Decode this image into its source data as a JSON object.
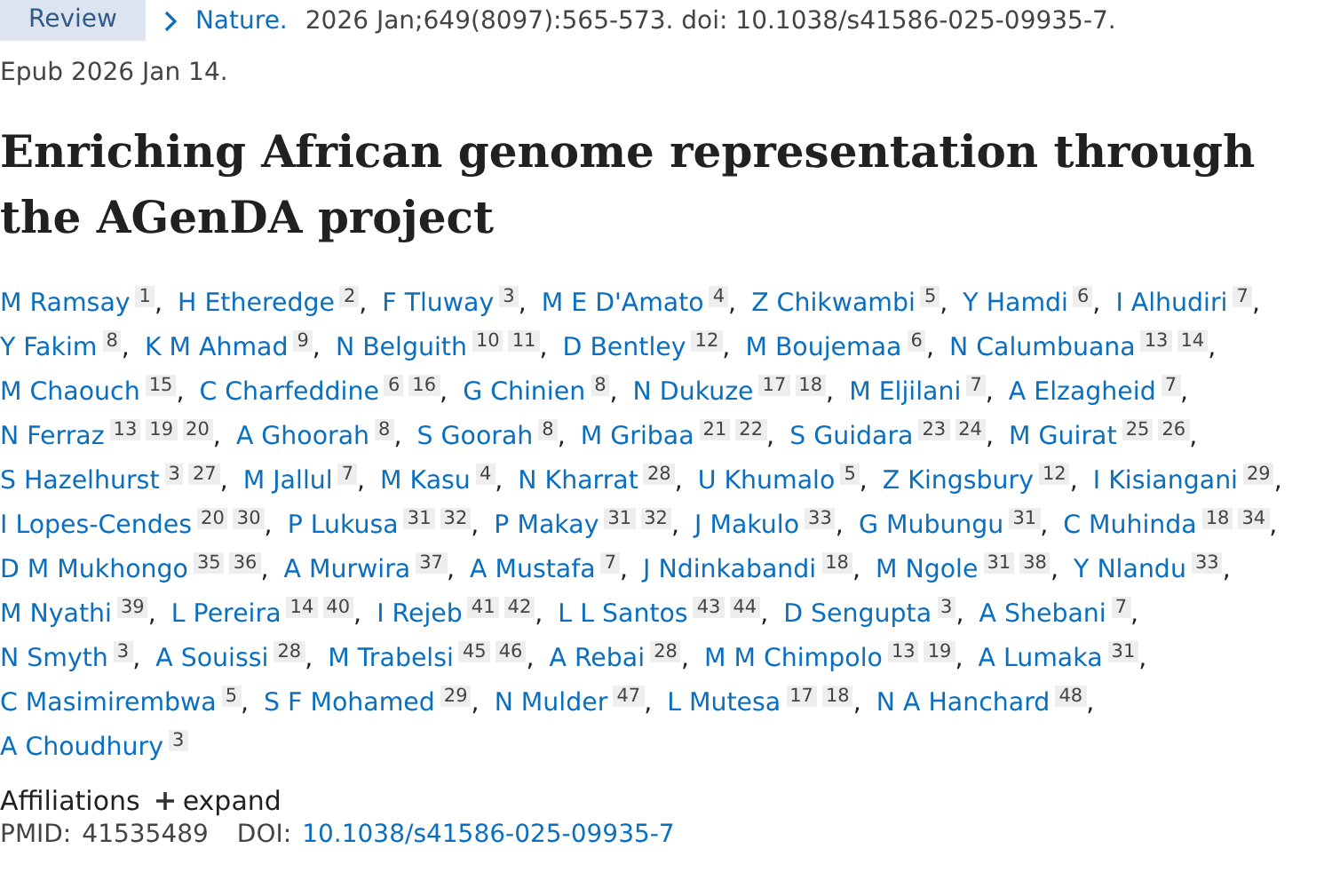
{
  "citation": {
    "badge": "Review",
    "journal": "Nature.",
    "details": "2026 Jan;649(8097):565-573. doi: 10.1038/s41586-025-09935-7.",
    "epub": "Epub 2026 Jan 14."
  },
  "title": "Enriching African genome representation through the AGenDA project",
  "authors": [
    {
      "name": "M Ramsay",
      "affiliations": [
        "1"
      ],
      "separator": ","
    },
    {
      "name": "H Etheredge",
      "affiliations": [
        "2"
      ],
      "separator": ","
    },
    {
      "name": "F Tluway",
      "affiliations": [
        "3"
      ],
      "separator": ","
    },
    {
      "name": "M E D'Amato",
      "affiliations": [
        "4"
      ],
      "separator": ","
    },
    {
      "name": "Z Chikwambi",
      "affiliations": [
        "5"
      ],
      "separator": ","
    },
    {
      "name": "Y Hamdi",
      "affiliations": [
        "6"
      ],
      "separator": ","
    },
    {
      "name": "I Alhudiri",
      "affiliations": [
        "7"
      ],
      "separator": ","
    },
    {
      "name": "Y Fakim",
      "affiliations": [
        "8"
      ],
      "separator": ","
    },
    {
      "name": "K M Ahmad",
      "affiliations": [
        "9"
      ],
      "separator": ","
    },
    {
      "name": "N Belguith",
      "affiliations": [
        "10",
        "11"
      ],
      "separator": ","
    },
    {
      "name": "D Bentley",
      "affiliations": [
        "12"
      ],
      "separator": ","
    },
    {
      "name": "M Boujemaa",
      "affiliations": [
        "6"
      ],
      "separator": ","
    },
    {
      "name": "N Calumbuana",
      "affiliations": [
        "13",
        "14"
      ],
      "separator": ","
    },
    {
      "name": "M Chaouch",
      "affiliations": [
        "15"
      ],
      "separator": ","
    },
    {
      "name": "C Charfeddine",
      "affiliations": [
        "6",
        "16"
      ],
      "separator": ","
    },
    {
      "name": "G Chinien",
      "affiliations": [
        "8"
      ],
      "separator": ","
    },
    {
      "name": "N Dukuze",
      "affiliations": [
        "17",
        "18"
      ],
      "separator": ","
    },
    {
      "name": "M Eljilani",
      "affiliations": [
        "7"
      ],
      "separator": ","
    },
    {
      "name": "A Elzagheid",
      "affiliations": [
        "7"
      ],
      "separator": ","
    },
    {
      "name": "N Ferraz",
      "affiliations": [
        "13",
        "19",
        "20"
      ],
      "separator": ","
    },
    {
      "name": "A Ghoorah",
      "affiliations": [
        "8"
      ],
      "separator": ","
    },
    {
      "name": "S Goorah",
      "affiliations": [
        "8"
      ],
      "separator": ","
    },
    {
      "name": "M Gribaa",
      "affiliations": [
        "21",
        "22"
      ],
      "separator": ","
    },
    {
      "name": "S Guidara",
      "affiliations": [
        "23",
        "24"
      ],
      "separator": ","
    },
    {
      "name": "M Guirat",
      "affiliations": [
        "25",
        "26"
      ],
      "separator": ","
    },
    {
      "name": "S Hazelhurst",
      "affiliations": [
        "3",
        "27"
      ],
      "separator": ","
    },
    {
      "name": "M Jallul",
      "affiliations": [
        "7"
      ],
      "separator": ","
    },
    {
      "name": "M Kasu",
      "affiliations": [
        "4"
      ],
      "separator": ","
    },
    {
      "name": "N Kharrat",
      "affiliations": [
        "28"
      ],
      "separator": ","
    },
    {
      "name": "U Khumalo",
      "affiliations": [
        "5"
      ],
      "separator": ","
    },
    {
      "name": "Z Kingsbury",
      "affiliations": [
        "12"
      ],
      "separator": ","
    },
    {
      "name": "I Kisiangani",
      "affiliations": [
        "29"
      ],
      "separator": ","
    },
    {
      "name": "I Lopes-Cendes",
      "affiliations": [
        "20",
        "30"
      ],
      "separator": ","
    },
    {
      "name": "P Lukusa",
      "affiliations": [
        "31",
        "32"
      ],
      "separator": ","
    },
    {
      "name": "P Makay",
      "affiliations": [
        "31",
        "32"
      ],
      "separator": ","
    },
    {
      "name": "J Makulo",
      "affiliations": [
        "33"
      ],
      "separator": ","
    },
    {
      "name": "G Mubungu",
      "affiliations": [
        "31"
      ],
      "separator": ","
    },
    {
      "name": "C Muhinda",
      "affiliations": [
        "18",
        "34"
      ],
      "separator": ","
    },
    {
      "name": "D M Mukhongo",
      "affiliations": [
        "35",
        "36"
      ],
      "separator": ","
    },
    {
      "name": "A Murwira",
      "affiliations": [
        "37"
      ],
      "separator": ","
    },
    {
      "name": "A Mustafa",
      "affiliations": [
        "7"
      ],
      "separator": ","
    },
    {
      "name": "J Ndinkabandi",
      "affiliations": [
        "18"
      ],
      "separator": ","
    },
    {
      "name": "M Ngole",
      "affiliations": [
        "31",
        "38"
      ],
      "separator": ","
    },
    {
      "name": "Y Nlandu",
      "affiliations": [
        "33"
      ],
      "separator": ","
    },
    {
      "name": "M Nyathi",
      "affiliations": [
        "39"
      ],
      "separator": ","
    },
    {
      "name": "L Pereira",
      "affiliations": [
        "14",
        "40"
      ],
      "separator": ","
    },
    {
      "name": "I Rejeb",
      "affiliations": [
        "41",
        "42"
      ],
      "separator": ","
    },
    {
      "name": "L L Santos",
      "affiliations": [
        "43",
        "44"
      ],
      "separator": ","
    },
    {
      "name": "D Sengupta",
      "affiliations": [
        "3"
      ],
      "separator": ","
    },
    {
      "name": "A Shebani",
      "affiliations": [
        "7"
      ],
      "separator": ","
    },
    {
      "name": "N Smyth",
      "affiliations": [
        "3"
      ],
      "separator": ","
    },
    {
      "name": "A Souissi",
      "affiliations": [
        "28"
      ],
      "separator": ","
    },
    {
      "name": "M Trabelsi",
      "affiliations": [
        "45",
        "46"
      ],
      "separator": ","
    },
    {
      "name": "A Rebai",
      "affiliations": [
        "28"
      ],
      "separator": ","
    },
    {
      "name": "M M Chimpolo",
      "affiliations": [
        "13",
        "19"
      ],
      "separator": ","
    },
    {
      "name": "A Lumaka",
      "affiliations": [
        "31"
      ],
      "separator": ","
    },
    {
      "name": "C Masimirembwa",
      "affiliations": [
        "5"
      ],
      "separator": ","
    },
    {
      "name": "S F Mohamed",
      "affiliations": [
        "29"
      ],
      "separator": ","
    },
    {
      "name": "N Mulder",
      "affiliations": [
        "47"
      ],
      "separator": ","
    },
    {
      "name": "L Mutesa",
      "affiliations": [
        "17",
        "18"
      ],
      "separator": ","
    },
    {
      "name": "N A Hanchard",
      "affiliations": [
        "48"
      ],
      "separator": ","
    },
    {
      "name": "A Choudhury",
      "affiliations": [
        "3"
      ]
    }
  ],
  "affiliations": {
    "label": "Affiliations",
    "toggle": "expand",
    "expanded": false
  },
  "identifiers": {
    "pmid_label": "PMID:",
    "pmid": "41535489",
    "doi_label": "DOI:",
    "doi": "10.1038/s41586-025-09935-7"
  }
}
